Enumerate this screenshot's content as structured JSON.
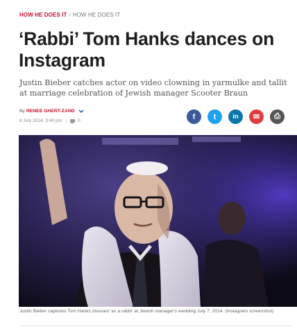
{
  "breadcrumb": {
    "primary": "HOW HE DOES IT",
    "separator": "/",
    "secondary": "HOW HE DOES IT"
  },
  "article": {
    "headline": "‘Rabbi’ Tom Hanks dances on Instagram",
    "subheadline": "Justin Bieber catches actor on video clowning in yarmulke and tallit at marriage celebration of Jewish manager Scooter Braun",
    "byline_prefix": "By",
    "author": "RENEE GHERT-ZAND",
    "date": "9 July 2014, 3:40 pm",
    "meta_separator": "|",
    "comment_count": "0",
    "image_caption": "Justin Bieber captures Tom Hanks dressed 'as a rabbi' at Jewish manager's wedding July 7, 2014. (Instagram screenshot)"
  },
  "share": {
    "facebook": "f",
    "twitter": "t",
    "linkedin": "in",
    "email": "✉",
    "print": "⎙"
  },
  "colors": {
    "accent": "#c8102e",
    "facebook": "#3b5998",
    "twitter": "#1da1f2",
    "linkedin": "#0e76a8",
    "email": "#e03e3e",
    "print": "#555555"
  }
}
